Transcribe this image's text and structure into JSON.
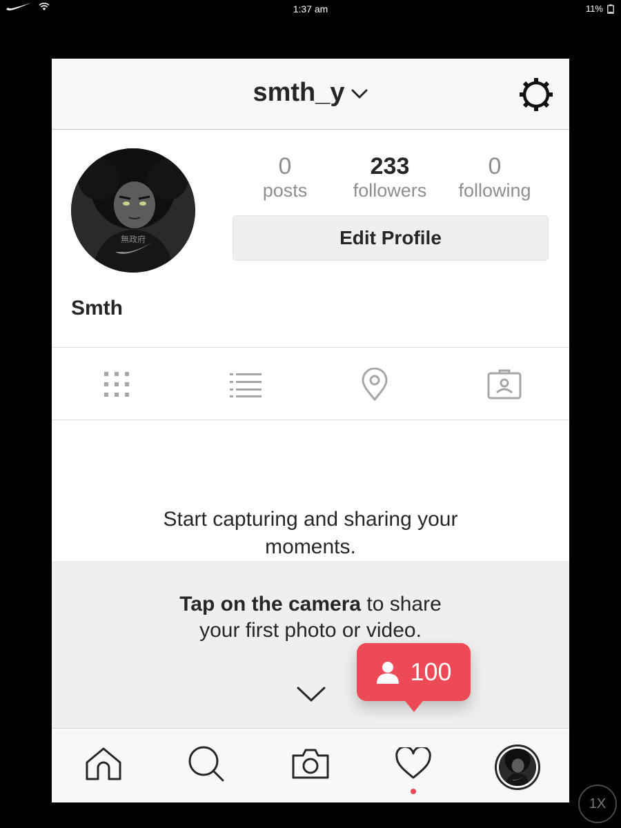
{
  "status_bar": {
    "time": "1:37 am",
    "battery": "11%"
  },
  "header": {
    "username": "smth_y"
  },
  "profile": {
    "display_name": "Smth",
    "stats": [
      {
        "count": "0",
        "label": "posts"
      },
      {
        "count": "233",
        "label": "followers"
      },
      {
        "count": "0",
        "label": "following"
      }
    ],
    "edit_profile_label": "Edit Profile"
  },
  "tabs": [
    "grid-icon",
    "list-icon",
    "location-pin-icon",
    "tagged-photos-icon"
  ],
  "empty_state": {
    "message": "Start capturing and sharing your moments.",
    "hint_bold": "Tap on the camera",
    "hint_rest": " to share your first photo or video."
  },
  "notification": {
    "count": "100"
  },
  "tab_bar": [
    "home-icon",
    "search-icon",
    "camera-icon",
    "heart-icon",
    "profile-avatar"
  ],
  "colors": {
    "accent": "#ed4956",
    "text": "#262626",
    "muted": "#8e8e8e"
  },
  "zoom_label": "1X"
}
